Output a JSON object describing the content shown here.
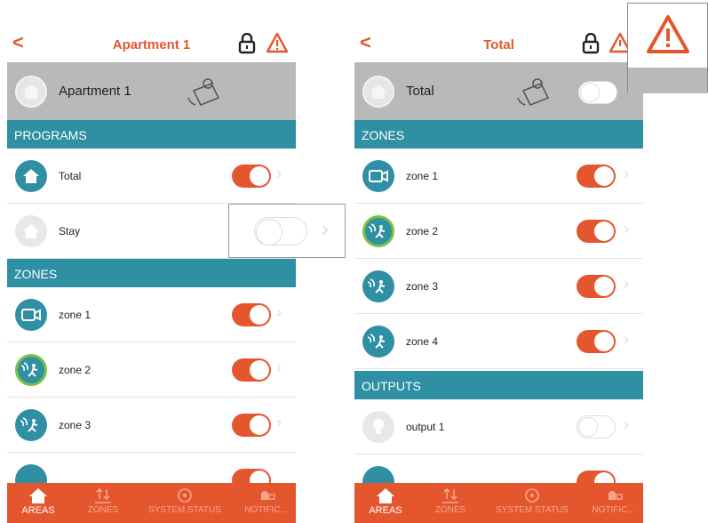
{
  "left": {
    "back": "<",
    "title": "Apartment 1",
    "area_name": "Apartment 1",
    "sections": {
      "programs": "PROGRAMS",
      "zones": "ZONES"
    },
    "programs": [
      {
        "label": "Total",
        "state": "on",
        "icon": "home-icon"
      },
      {
        "label": "Stay",
        "state": "off",
        "icon": "home-icon"
      }
    ],
    "zones": [
      {
        "label": "zone 1",
        "state": "on",
        "icon": "camera-icon"
      },
      {
        "label": "zone 2",
        "state": "on",
        "icon": "motion-sensor-icon"
      },
      {
        "label": "zone 3",
        "state": "on",
        "icon": "motion-sensor-icon"
      }
    ]
  },
  "right": {
    "back": "<",
    "title": "Total",
    "area_name": "Total",
    "area_toggle": "off",
    "sections": {
      "zones": "ZONES",
      "outputs": "OUTPUTS"
    },
    "zones": [
      {
        "label": "zone 1",
        "state": "on",
        "icon": "camera-icon"
      },
      {
        "label": "zone 2",
        "state": "on",
        "icon": "motion-sensor-icon"
      },
      {
        "label": "zone 3",
        "state": "on",
        "icon": "motion-sensor-icon"
      },
      {
        "label": "zone 4",
        "state": "on",
        "icon": "motion-sensor-icon"
      }
    ],
    "outputs": [
      {
        "label": "output 1",
        "state": "off",
        "icon": "lightbulb-icon"
      }
    ]
  },
  "tabs": [
    "AREAS",
    "ZONES",
    "SYSTEM STATUS",
    "NOTIFIC..."
  ],
  "colors": {
    "accent": "#e4572e",
    "section": "#2f8fa3",
    "area_bar": "#b9b9b9",
    "active_zone_ring": "#7cc242"
  }
}
